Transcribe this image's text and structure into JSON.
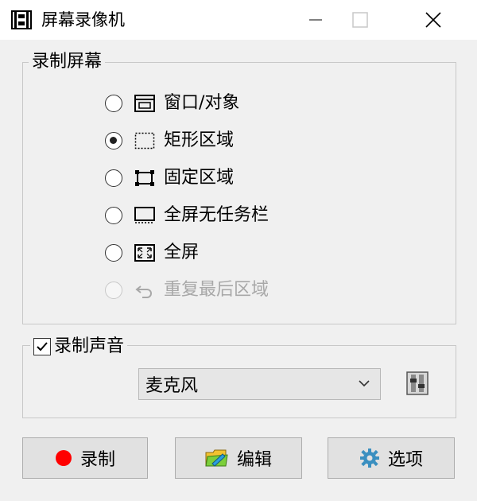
{
  "window": {
    "title": "屏幕录像机"
  },
  "screen_group": {
    "title": "录制屏幕",
    "options": [
      {
        "label": "窗口/对象",
        "icon": "window-icon",
        "selected": false,
        "enabled": true
      },
      {
        "label": "矩形区域",
        "icon": "dashed-rectangle-icon",
        "selected": true,
        "enabled": true
      },
      {
        "label": "固定区域",
        "icon": "fixed-region-icon",
        "selected": false,
        "enabled": true
      },
      {
        "label": "全屏无任务栏",
        "icon": "screen-no-taskbar-icon",
        "selected": false,
        "enabled": true
      },
      {
        "label": "全屏",
        "icon": "fullscreen-icon",
        "selected": false,
        "enabled": true
      },
      {
        "label": "重复最后区域",
        "icon": "repeat-icon",
        "selected": false,
        "enabled": false
      }
    ]
  },
  "audio_group": {
    "title": "录制声音",
    "checked": true,
    "device": "麦克风"
  },
  "buttons": {
    "record": "录制",
    "edit": "编辑",
    "options": "选项"
  },
  "colors": {
    "record_dot": "#ff0000",
    "background": "#f0f0f0"
  }
}
